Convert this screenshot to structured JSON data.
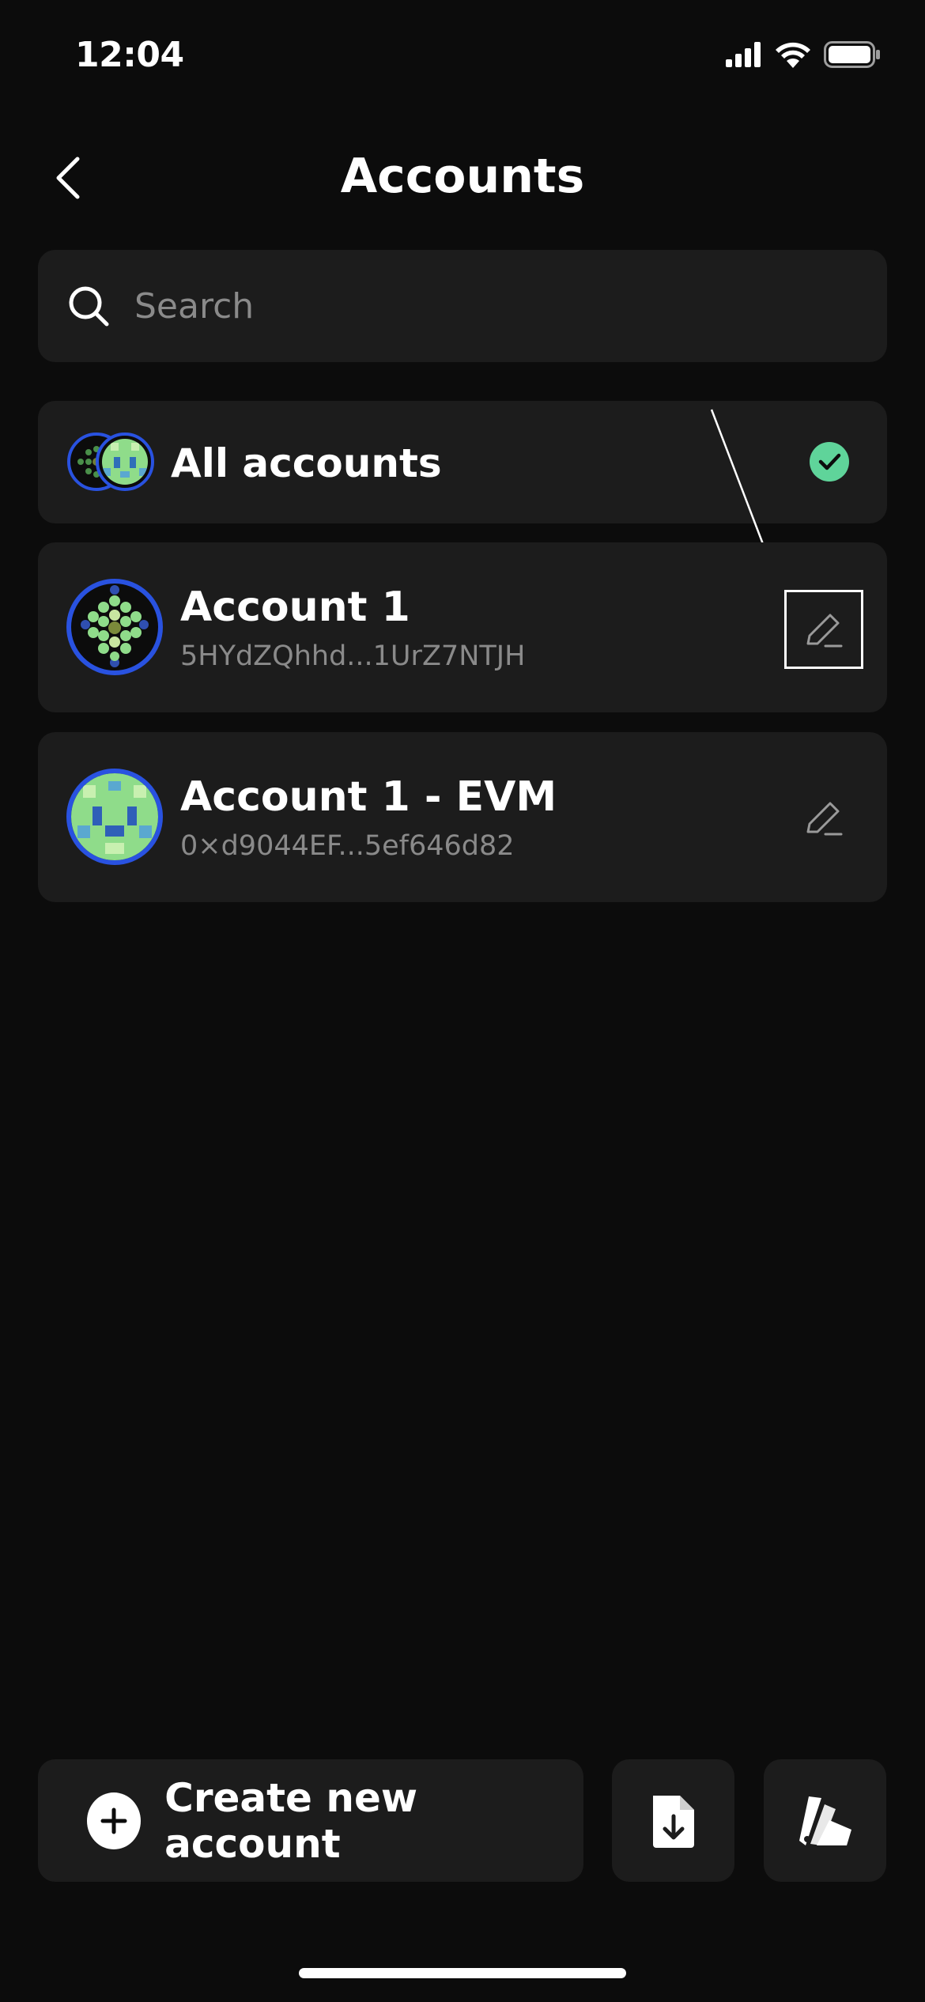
{
  "status_bar": {
    "time": "12:04"
  },
  "header": {
    "title": "Accounts"
  },
  "search": {
    "placeholder": "Search",
    "value": ""
  },
  "all_accounts": {
    "label": "All accounts",
    "selected": true
  },
  "accounts": [
    {
      "name": "Account 1",
      "address": "5HYdZQhhd...1UrZ7NTJH"
    },
    {
      "name": "Account 1 - EVM",
      "address": "0×d9044EF...5ef646d82"
    }
  ],
  "footer": {
    "create_label": "Create new account"
  },
  "icons": {
    "back": "chevron-left-icon",
    "search": "search-icon",
    "check": "check-circle-icon",
    "edit": "pencil-icon",
    "create": "plus-circle-icon",
    "import": "file-download-icon",
    "attach": "swatch-icon"
  },
  "colors": {
    "background": "#0c0c0c",
    "card": "#1c1c1c",
    "accent_green": "#5fd49a",
    "avatar_ring": "#2952e0",
    "muted_text": "#8a8a8a"
  }
}
